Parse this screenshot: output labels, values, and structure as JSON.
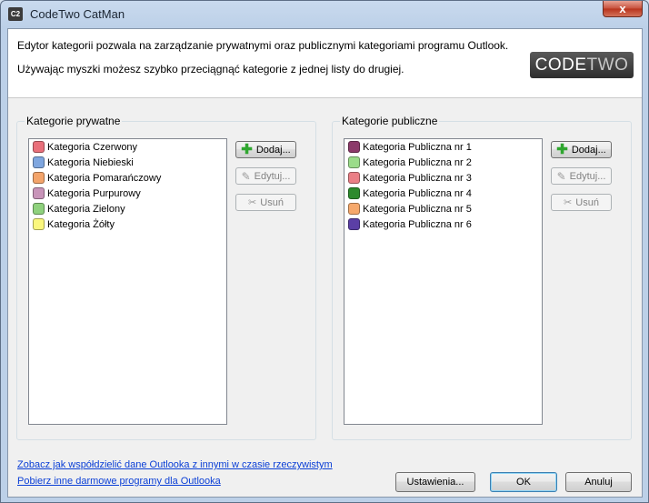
{
  "window": {
    "app_icon": "C2",
    "title": "CodeTwo CatMan",
    "close_label": "x"
  },
  "header": {
    "description1": "Edytor kategorii pozwala na zarządzanie prywatnymi oraz publicznymi kategoriami programu Outlook.",
    "description2": "Używając myszki możesz szybko przeciągnąć kategorie z jednej listy do drugiej.",
    "logo_part1": "CODE",
    "logo_part2": "TWO"
  },
  "private_group": {
    "title": "Kategorie prywatne",
    "items": [
      {
        "label": "Kategoria Czerwony",
        "color": "#e9707b"
      },
      {
        "label": "Kategoria Niebieski",
        "color": "#7fa6df"
      },
      {
        "label": "Kategoria Pomarańczowy",
        "color": "#f3a46b"
      },
      {
        "label": "Kategoria Purpurowy",
        "color": "#c894b9"
      },
      {
        "label": "Kategoria Zielony",
        "color": "#8fd17d"
      },
      {
        "label": "Kategoria Żółty",
        "color": "#fbf77d"
      }
    ],
    "add_label": "Dodaj...",
    "edit_label": "Edytuj...",
    "delete_label": "Usuń"
  },
  "public_group": {
    "title": "Kategorie publiczne",
    "items": [
      {
        "label": "Kategoria Publiczna nr 1",
        "color": "#8c3a6a"
      },
      {
        "label": "Kategoria Publiczna nr 2",
        "color": "#9bdc8a"
      },
      {
        "label": "Kategoria Publiczna nr 3",
        "color": "#ea7f86"
      },
      {
        "label": "Kategoria Publiczna nr 4",
        "color": "#2c8a2c"
      },
      {
        "label": "Kategoria Publiczna nr 5",
        "color": "#f6a86b"
      },
      {
        "label": "Kategoria Publiczna nr 6",
        "color": "#5b3fa6"
      }
    ],
    "add_label": "Dodaj...",
    "edit_label": "Edytuj...",
    "delete_label": "Usuń"
  },
  "footer": {
    "link1": "Zobacz jak współdzielić dane Outlooka z innymi w czasie rzeczywistym",
    "link2": "Pobierz inne darmowe programy dla Outlooka",
    "settings_label": "Ustawienia...",
    "ok_label": "OK",
    "cancel_label": "Anuluj"
  },
  "icons": {
    "add": "plus-icon",
    "edit": "pencil-icon",
    "delete": "scissors-icon"
  }
}
